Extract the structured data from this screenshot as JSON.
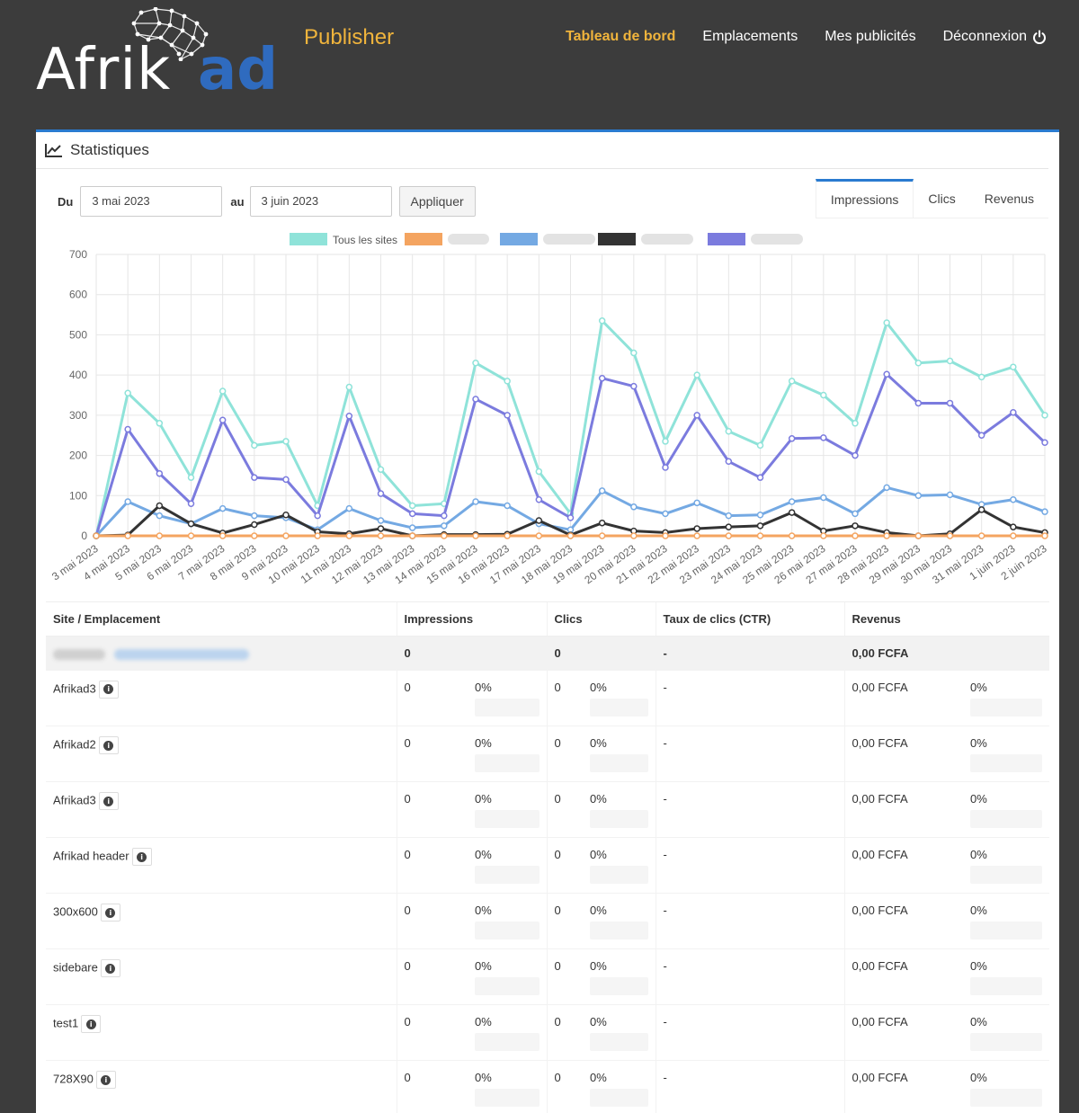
{
  "header": {
    "logo_text": "Afrik",
    "logo_suffix": "ad",
    "section": "Publisher",
    "nav": [
      {
        "label": "Tableau de bord",
        "active": true
      },
      {
        "label": "Emplacements",
        "active": false
      },
      {
        "label": "Mes publicités",
        "active": false
      },
      {
        "label": "Déconnexion",
        "active": false,
        "icon": "power-icon"
      }
    ]
  },
  "panel": {
    "title": "Statistiques",
    "title_icon": "line-chart-icon",
    "date_from_label": "Du",
    "date_from": "3 mai 2023",
    "date_to_label": "au",
    "date_to": "3 juin 2023",
    "apply_label": "Appliquer",
    "tabs": [
      {
        "label": "Impressions",
        "active": true
      },
      {
        "label": "Clics",
        "active": false
      },
      {
        "label": "Revenus",
        "active": false
      }
    ]
  },
  "chart_data": {
    "type": "line",
    "xlabel": "",
    "ylabel": "",
    "ylim": [
      0,
      700
    ],
    "yticks": [
      0,
      100,
      200,
      300,
      400,
      500,
      600,
      700
    ],
    "grid": true,
    "legend": "top-center",
    "categories": [
      "3 mai 2023",
      "4 mai 2023",
      "5 mai 2023",
      "6 mai 2023",
      "7 mai 2023",
      "8 mai 2023",
      "9 mai 2023",
      "10 mai 2023",
      "11 mai 2023",
      "12 mai 2023",
      "13 mai 2023",
      "14 mai 2023",
      "15 mai 2023",
      "16 mai 2023",
      "17 mai 2023",
      "18 mai 2023",
      "19 mai 2023",
      "20 mai 2023",
      "21 mai 2023",
      "22 mai 2023",
      "23 mai 2023",
      "24 mai 2023",
      "25 mai 2023",
      "26 mai 2023",
      "27 mai 2023",
      "28 mai 2023",
      "29 mai 2023",
      "30 mai 2023",
      "31 mai 2023",
      "1 juin 2023",
      "2 juin 2023"
    ],
    "series": [
      {
        "name": "Tous les sites",
        "color": "#8fe3d9",
        "values": [
          0,
          355,
          280,
          145,
          360,
          225,
          235,
          75,
          370,
          165,
          75,
          80,
          430,
          385,
          160,
          55,
          535,
          455,
          235,
          400,
          260,
          225,
          385,
          350,
          280,
          530,
          430,
          435,
          395,
          420,
          300
        ]
      },
      {
        "name": "",
        "color": "#f4a460",
        "values": [
          0,
          0,
          0,
          0,
          0,
          0,
          0,
          0,
          0,
          0,
          0,
          0,
          0,
          0,
          0,
          0,
          0,
          0,
          0,
          0,
          0,
          0,
          0,
          0,
          0,
          0,
          0,
          0,
          0,
          0,
          0
        ]
      },
      {
        "name": "",
        "color": "#74a9e3",
        "values": [
          0,
          85,
          50,
          30,
          68,
          50,
          45,
          15,
          68,
          38,
          20,
          25,
          85,
          75,
          30,
          15,
          112,
          72,
          55,
          82,
          50,
          52,
          85,
          95,
          55,
          120,
          100,
          102,
          78,
          90,
          60
        ]
      },
      {
        "name": "",
        "color": "#333333",
        "values": [
          0,
          2,
          75,
          30,
          7,
          28,
          52,
          10,
          5,
          18,
          0,
          3,
          3,
          4,
          38,
          2,
          32,
          12,
          8,
          18,
          22,
          25,
          58,
          12,
          25,
          8,
          0,
          5,
          65,
          22,
          8
        ]
      },
      {
        "name": "",
        "color": "#7b7bde",
        "values": [
          0,
          265,
          155,
          80,
          288,
          145,
          140,
          50,
          298,
          105,
          55,
          50,
          340,
          300,
          90,
          45,
          392,
          372,
          170,
          300,
          185,
          145,
          242,
          244,
          200,
          402,
          330,
          330,
          250,
          307,
          232
        ]
      }
    ]
  },
  "table": {
    "headers": [
      "Site / Emplacement",
      "Impressions",
      "Clics",
      "Taux de clics (CTR)",
      "Revenus"
    ],
    "summary": {
      "impressions": "0",
      "clicks": "0",
      "ctr": "-",
      "revenue": "0,00 FCFA"
    },
    "rows": [
      {
        "name": "Afrikad3",
        "impressions": "0",
        "imp_pct": "0%",
        "clicks": "0",
        "clk_pct": "0%",
        "ctr": "-",
        "revenue": "0,00 FCFA",
        "rev_pct": "0%"
      },
      {
        "name": "Afrikad2",
        "impressions": "0",
        "imp_pct": "0%",
        "clicks": "0",
        "clk_pct": "0%",
        "ctr": "-",
        "revenue": "0,00 FCFA",
        "rev_pct": "0%"
      },
      {
        "name": "Afrikad3",
        "impressions": "0",
        "imp_pct": "0%",
        "clicks": "0",
        "clk_pct": "0%",
        "ctr": "-",
        "revenue": "0,00 FCFA",
        "rev_pct": "0%"
      },
      {
        "name": "Afrikad header",
        "impressions": "0",
        "imp_pct": "0%",
        "clicks": "0",
        "clk_pct": "0%",
        "ctr": "-",
        "revenue": "0,00 FCFA",
        "rev_pct": "0%"
      },
      {
        "name": "300x600",
        "impressions": "0",
        "imp_pct": "0%",
        "clicks": "0",
        "clk_pct": "0%",
        "ctr": "-",
        "revenue": "0,00 FCFA",
        "rev_pct": "0%"
      },
      {
        "name": "sidebare",
        "impressions": "0",
        "imp_pct": "0%",
        "clicks": "0",
        "clk_pct": "0%",
        "ctr": "-",
        "revenue": "0,00 FCFA",
        "rev_pct": "0%"
      },
      {
        "name": "test1",
        "impressions": "0",
        "imp_pct": "0%",
        "clicks": "0",
        "clk_pct": "0%",
        "ctr": "-",
        "revenue": "0,00 FCFA",
        "rev_pct": "0%"
      },
      {
        "name": "728X90",
        "impressions": "0",
        "imp_pct": "0%",
        "clicks": "0",
        "clk_pct": "0%",
        "ctr": "-",
        "revenue": "0,00 FCFA",
        "rev_pct": "0%"
      }
    ]
  }
}
